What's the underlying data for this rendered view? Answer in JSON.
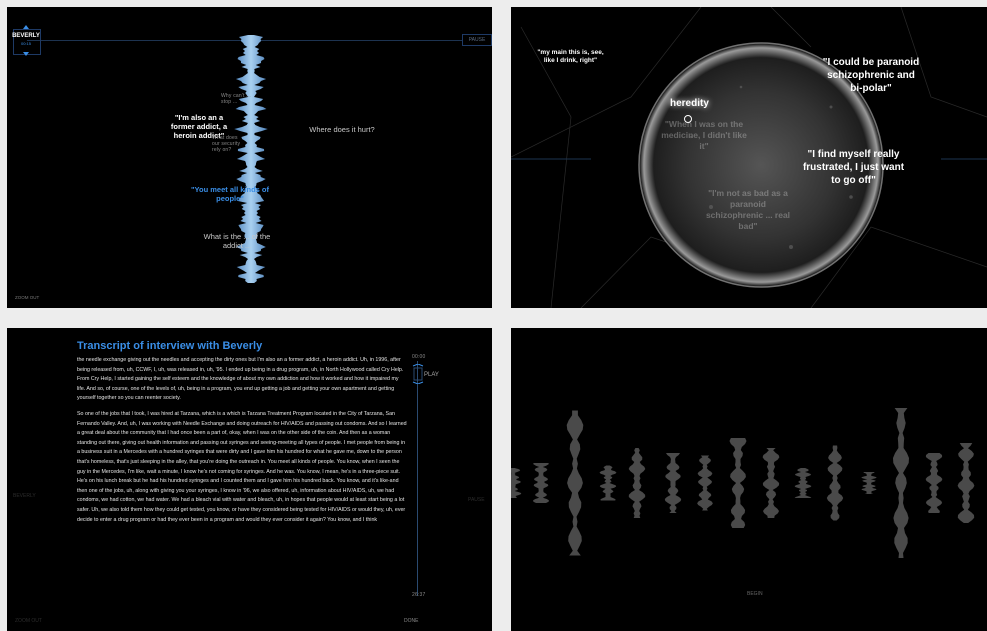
{
  "panel1": {
    "person_name": "BEVERLY",
    "time_label": "00:15",
    "pause_label": "PAUSE",
    "zoom_label": "ZOOM OUT",
    "quotes": {
      "former_addict": "\"I'm also an a former addict, a heroin addict\"",
      "where_hurt": "Where does it hurt?",
      "meet_all": "\"You meet all kinds of people\"",
      "what_is": "What is the ... of the addict ...",
      "small_1": "Why can't ... stop ...",
      "small_2": "What does our security rely on?"
    }
  },
  "panel2": {
    "quote_drink": "\"my main this is, see, like I drink, right\"",
    "quote_paranoid": "\"I could be paranoid schizophrenic and bi-polar\"",
    "quote_frustrated": "\"I find myself really frustrated, I just want to go off\"",
    "heredity": "heredity",
    "quote_medicine": "\"When I was on the medicine, I didn't like it\"",
    "quote_not_bad": "\"I'm not as bad as a paranoid schizophrenic ... real bad\""
  },
  "panel3": {
    "title": "Transcript of interview with Beverly",
    "paragraph1": "the needle exchange giving out the needles and accepting the dirty ones but I'm also an a former addict, a heroin addict. Uh, in 1996, after being released from, uh, CCWF, I, uh, was released in, uh, '95. I ended up being in a drug program, uh, in North Hollywood called Cry Help. From Cry Help, I started gaining the self esteem and the knowledge of about my own addiction and how it worked and how it impaired my life. And so, of course, one of the levels of, uh, being in a program, you end up getting a job and getting your own apartment and getting yourself together so you can reenter society.",
    "paragraph2": "So one of the jobs that I took, I was hired at Tarzana, which is a which is Tarzana Treatment Program located in the City of Tarzana, San Fernando Valley. And, uh, I was working with Needle Exchange and doing outreach for HIV/AIDS and passing out condoms. And so I learned a great deal about the community that I had once been a part of, okay, when I was on the other side of the coin. And then as a woman standing out there, giving out health information and passing out syringes and seeing-meeting all types of people. I met people from being in a business suit in a Mercedes with a hundred syringes that were dirty and I gave him his hundred for what he gave me, down to the person that's homeless, that's just sleeping in the alley, that you're doing the outreach in. You meet all kinds of people. You know, when I seen the guy in the Mercedes, I'm like, wait a minute, I know he's not coming for syringes. And he was. You know, I mean, he's in a three-piece suit. He's on his lunch break but he had his hundred syringes and I counted them and I gave him his hundred back. You know, and it's like-and then one of the jobs, uh, along with giving you your syringes, I know in '96, we also offered, uh, information about HIV/AIDS, uh, we had condoms, we had cotton, we had water. We had a bleach vial with water and bleach, uh, in hopes that people would at least start being a lot safer. Uh, we also told them how they could get tested, you know, or have they considered being tested for HIV/AIDS or would they, uh, ever decide to enter a drug program or had they ever been in a program and would they ever consider it again? You know, and I think",
    "play_label": "PLAY",
    "time_top": "00:00",
    "time_bottom": "26:37",
    "done_label": "DONE",
    "ghost_name": "BEVERLY",
    "ghost_pause": "PAUSE",
    "ghost_zoom": "ZOOM OUT"
  },
  "panel4": {
    "begin_label": "BEGIN"
  },
  "colors": {
    "accent": "#3a8ee6",
    "background": "#000000",
    "frame": "#ededed"
  }
}
